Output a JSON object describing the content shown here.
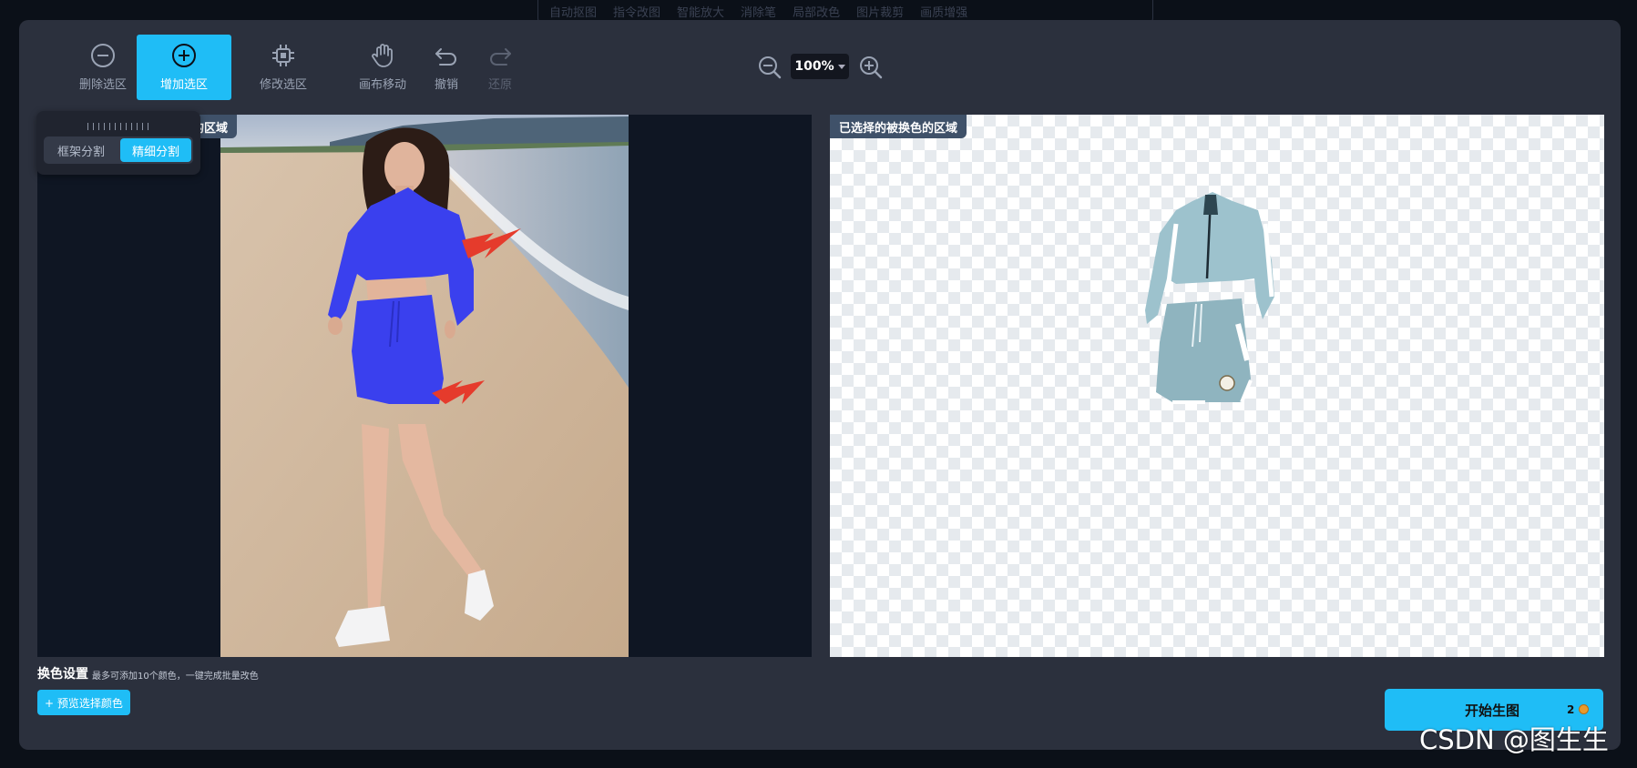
{
  "background_toolbar": [
    "自动抠图",
    "指令改图",
    "智能放大",
    "消除笔",
    "局部改色",
    "图片裁剪",
    "画质增强"
  ],
  "toolbar": {
    "remove_selection": "删除选区",
    "add_selection": "增加选区",
    "modify_selection": "修改选区",
    "canvas_move": "画布移动",
    "undo": "撤销",
    "redo": "还原"
  },
  "zoom": {
    "value": "100%"
  },
  "left_pane": {
    "label": "的区域"
  },
  "segmentation": {
    "box": "框架分割",
    "fine": "精细分割",
    "selected": "精细分割"
  },
  "right_pane": {
    "label": "已选择的被换色的区域"
  },
  "color_settings": {
    "title": "换色设置",
    "hint": "最多可添加10个颜色，一键完成批量改色",
    "preview_button": "+ 预览选择颜色"
  },
  "start_button": {
    "label": "开始生图",
    "cost": "2"
  },
  "watermark": "CSDN @图生生",
  "colors": {
    "accent": "#1fbdf6",
    "modal_bg": "#2b303d",
    "selection_blue": "#3a40ee",
    "arrow": "#e53b2c"
  },
  "icons": [
    "minus-circle-icon",
    "plus-circle-icon",
    "chip-edit-icon",
    "hand-icon",
    "undo-icon",
    "redo-icon",
    "zoom-out-icon",
    "zoom-in-icon",
    "coin-icon"
  ]
}
